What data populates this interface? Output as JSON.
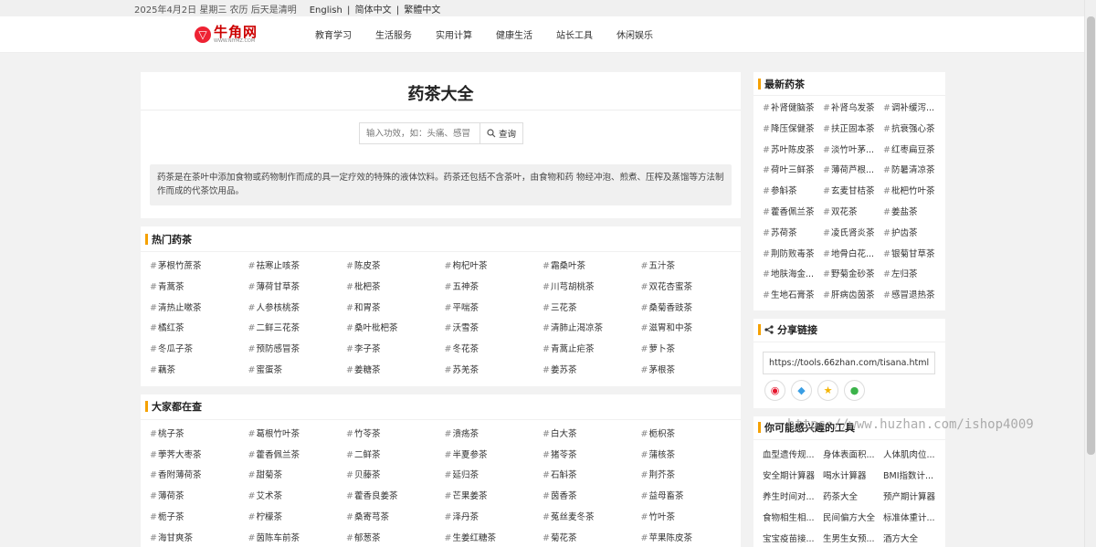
{
  "topbar": {
    "date": "2025年4月2日 星期三 农历 后天是清明",
    "lang_en": "English",
    "lang_sc": "简体中文",
    "lang_tc": "繁體中文",
    "sep": "|"
  },
  "logo": {
    "name": "牛角网",
    "sub": "WWW.NIYMZ.COM",
    "mark": "▽"
  },
  "menu": [
    "教育学习",
    "生活服务",
    "实用计算",
    "健康生活",
    "站长工具",
    "休闲娱乐"
  ],
  "hero": {
    "title": "药茶大全",
    "search_placeholder": "输入功效，如：头痛、感冒",
    "search_button": "查询",
    "intro": "药茶是在茶叶中添加食物或药物制作而成的具一定疗效的特殊的液体饮料。药茶还包括不含茶叶，由食物和药 物经冲泡、煎煮、压榨及蒸馏等方法制作而成的代茶饮用品。"
  },
  "hot": {
    "title": "热门药茶",
    "tags": [
      "茅根竹蔗茶",
      "祛寒止咳茶",
      "陈皮茶",
      "枸杞叶茶",
      "霜桑叶茶",
      "五汁茶",
      "青蒿茶",
      "薄荷甘草茶",
      "枇杷茶",
      "五神茶",
      "川芎胡桃茶",
      "双花杏蜜茶",
      "清热止嗽茶",
      "人参核桃茶",
      "和胃茶",
      "平喘茶",
      "三花茶",
      "桑菊香豉茶",
      "橘红茶",
      "二鲜三花茶",
      "桑叶枇杷茶",
      "沃雪茶",
      "清肺止渴凉茶",
      "滋胃和中茶",
      "冬瓜子茶",
      "预防感冒茶",
      "李子茶",
      "冬花茶",
      "青蒿止疟茶",
      "萝卜茶",
      "藕茶",
      "蜜蛋茶",
      "姜糖茶",
      "苏羌茶",
      "姜苏茶",
      "茅根茶"
    ]
  },
  "popular": {
    "title": "大家都在查",
    "tags": [
      "桃子茶",
      "葛根竹叶茶",
      "竹苓茶",
      "溃疡茶",
      "白大茶",
      "栀枳茶",
      "荸荠大枣茶",
      "藿香佩兰茶",
      "二鲜茶",
      "半夏参茶",
      "猪苓茶",
      "蒲核茶",
      "香附薄荷茶",
      "甜菊茶",
      "贝藤茶",
      "延归茶",
      "石斛茶",
      "荆芥茶",
      "薄荷茶",
      "艾术茶",
      "藿香良姜茶",
      "芒果姜茶",
      "茵香茶",
      "益母畜茶",
      "栀子茶",
      "柠檬茶",
      "桑寄芎茶",
      "泽丹茶",
      "菟丝麦冬茶",
      "竹叶茶",
      "海甘爽茶",
      "茵陈车前茶",
      "郁葱茶",
      "生姜红糖茶",
      "菊花茶",
      "苹果陈皮茶"
    ]
  },
  "latest": {
    "title": "最新药茶",
    "tags": [
      "补肾健脑茶",
      "补肾乌发茶",
      "调补缓泻...",
      "降压保健茶",
      "扶正固本茶",
      "抗衰强心茶",
      "苏叶陈皮茶",
      "淡竹叶茅...",
      "红枣扁豆茶",
      "荷叶三鲜茶",
      "薄荷芦根...",
      "防暑清凉茶",
      "参斛茶",
      "玄麦甘桔茶",
      "枇杷竹叶茶",
      "藿香佩兰茶",
      "双花茶",
      "姜盐茶",
      "苏荷茶",
      "凌氏肾炎茶",
      "护齿茶",
      "荆防败毒茶",
      "地骨白花...",
      "银菊甘草茶",
      "地肤海金...",
      "野菊金砂茶",
      "左归茶",
      "生地石膏茶",
      "肝病齿茵茶",
      "感冒退热茶"
    ]
  },
  "share": {
    "title": "分享链接",
    "url": "https://tools.66zhan.com/tisana.html",
    "icons": [
      "weibo-icon",
      "qq-icon",
      "qzone-icon",
      "wechat-icon"
    ]
  },
  "tools": {
    "title": "你可能感兴趣的工具",
    "items": [
      "血型遗传规...",
      "身体表面积...",
      "人体肌肉位...",
      "安全期计算器",
      "喝水计算器",
      "BMI指数计...",
      "养生时间对...",
      "药茶大全",
      "预产期计算器",
      "食物相生相...",
      "民间偏方大全",
      "标准体重计...",
      "宝宝疫苗接...",
      "生男生女预...",
      "酒方大全"
    ]
  },
  "watermark": "https://www.huzhan.com/ishop4009",
  "colors": {
    "accent": "#f5a100",
    "brand": "#cc0000"
  }
}
